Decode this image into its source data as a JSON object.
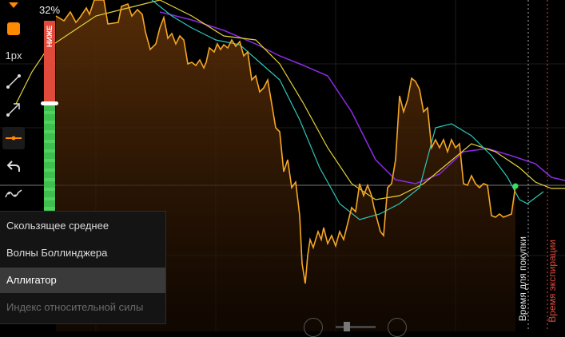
{
  "sentiment": {
    "percent": "32%",
    "down_label": "НИЖЕ",
    "down_share": 0.32
  },
  "toolbar": {
    "line_width_label": "1px",
    "color_swatch": "#ff8a00",
    "items": [
      "dropdown-arrow-icon",
      "color-swatch",
      "line-width",
      "line-icon",
      "arrow-line-icon",
      "horizontal-line-icon",
      "undo-icon",
      "indicator-icon"
    ]
  },
  "menu": {
    "items": [
      {
        "label": "Скользящее среднее",
        "state": "normal"
      },
      {
        "label": "Волны Боллинджера",
        "state": "normal"
      },
      {
        "label": "Аллигатор",
        "state": "selected"
      },
      {
        "label": "Индекс относительной силы",
        "state": "disabled"
      }
    ]
  },
  "chart": {
    "purchase_time_label": "Время для покупки",
    "expiration_label": "Время экспирации",
    "colors": {
      "price": "#f5a623",
      "jaw": "#8a2be2",
      "teeth": "#e6d23a",
      "lips": "#2ec8b8",
      "current_point": "#35e060",
      "expiration": "#e04a3a"
    }
  }
}
